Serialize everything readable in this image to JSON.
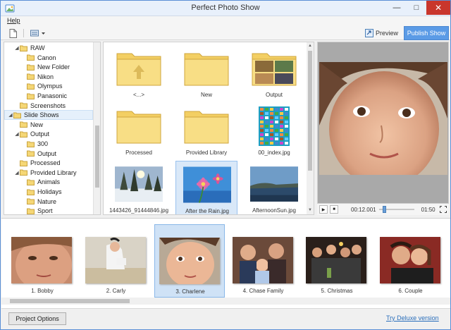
{
  "window": {
    "title": "Perfect Photo Show"
  },
  "menu": {
    "help": "Help"
  },
  "toolbar": {
    "preview_label": "Preview",
    "publish_label": "Publish Show"
  },
  "tree": {
    "items": [
      {
        "label": "RAW",
        "level": 1,
        "arrow": "open"
      },
      {
        "label": "Canon",
        "level": 2,
        "arrow": ""
      },
      {
        "label": "New Folder",
        "level": 2,
        "arrow": ""
      },
      {
        "label": "Nikon",
        "level": 2,
        "arrow": ""
      },
      {
        "label": "Olympus",
        "level": 2,
        "arrow": ""
      },
      {
        "label": "Panasonic",
        "level": 2,
        "arrow": ""
      },
      {
        "label": "Screenshots",
        "level": 1,
        "arrow": ""
      },
      {
        "label": "Slide Shows",
        "level": 0,
        "arrow": "open",
        "selected": true
      },
      {
        "label": "New",
        "level": 1,
        "arrow": ""
      },
      {
        "label": "Output",
        "level": 1,
        "arrow": "open"
      },
      {
        "label": "300",
        "level": 2,
        "arrow": ""
      },
      {
        "label": "Output",
        "level": 2,
        "arrow": ""
      },
      {
        "label": "Processed",
        "level": 1,
        "arrow": ""
      },
      {
        "label": "Provided Library",
        "level": 1,
        "arrow": "open"
      },
      {
        "label": "Animals",
        "level": 2,
        "arrow": ""
      },
      {
        "label": "Holidays",
        "level": 2,
        "arrow": ""
      },
      {
        "label": "Nature",
        "level": 2,
        "arrow": ""
      },
      {
        "label": "Sport",
        "level": 2,
        "arrow": ""
      }
    ]
  },
  "files": {
    "items": [
      {
        "label": "<...>",
        "kind": "folder-up"
      },
      {
        "label": "New",
        "kind": "folder"
      },
      {
        "label": "Output",
        "kind": "folder-photos"
      },
      {
        "label": "Processed",
        "kind": "folder"
      },
      {
        "label": "Provided Library",
        "kind": "folder"
      },
      {
        "label": "00_index.jpg",
        "kind": "image-index"
      },
      {
        "label": "1443426_91444846.jpg",
        "kind": "image-snow"
      },
      {
        "label": "After the Rain.jpg",
        "kind": "image-flower",
        "selected": true
      },
      {
        "label": "AfternoonSun.jpg",
        "kind": "image-sea"
      }
    ]
  },
  "player": {
    "current_time": "00:12.001",
    "end_time": "01:50",
    "progress": 0.11
  },
  "slides": {
    "items": [
      {
        "label": "1. Bobby"
      },
      {
        "label": "2. Carly"
      },
      {
        "label": "3. Charlene",
        "selected": true
      },
      {
        "label": "4. Chase Family"
      },
      {
        "label": "5. Christmas"
      },
      {
        "label": "6. Couple"
      }
    ]
  },
  "footer": {
    "options_label": "Project Options",
    "deluxe_link": "Try Deluxe version"
  },
  "colors": {
    "accent": "#5b9be6",
    "close": "#c9362c",
    "folder": "#f5d776",
    "link": "#2a6ebb"
  }
}
